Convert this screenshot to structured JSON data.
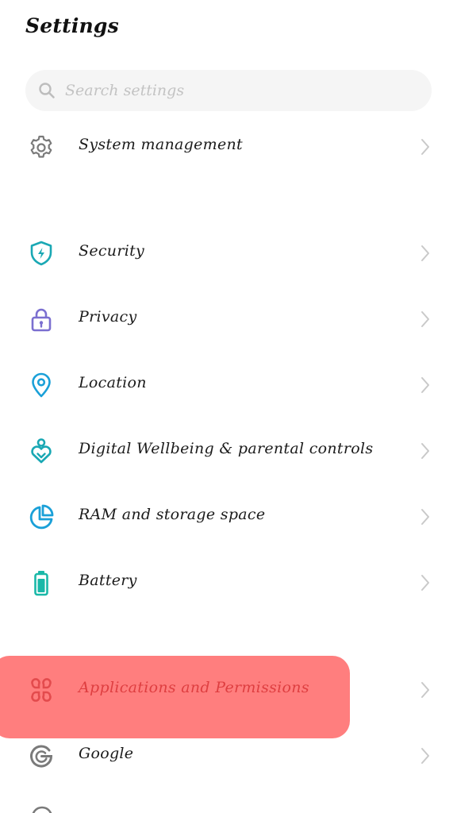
{
  "header": {
    "title": "Settings"
  },
  "search": {
    "placeholder": "Search settings"
  },
  "items": [
    {
      "label": "System management",
      "icon": "gear-icon"
    },
    {
      "label": "Security",
      "icon": "shield-icon"
    },
    {
      "label": "Privacy",
      "icon": "lock-icon"
    },
    {
      "label": "Location",
      "icon": "location-pin-icon"
    },
    {
      "label": "Digital Wellbeing & parental controls",
      "icon": "wellbeing-heart-icon"
    },
    {
      "label": "RAM and storage space",
      "icon": "storage-pie-icon"
    },
    {
      "label": "Battery",
      "icon": "battery-icon"
    },
    {
      "label": "Applications and Permissions",
      "icon": "apps-grid-icon"
    },
    {
      "label": "Google",
      "icon": "google-icon"
    }
  ],
  "colors": {
    "accent_teal": "#1aa8b4",
    "accent_purple": "#7b6fd0",
    "icon_gray": "#7a7a7a",
    "highlight": "#ff4c4c",
    "chevron": "#c9c9c9"
  }
}
